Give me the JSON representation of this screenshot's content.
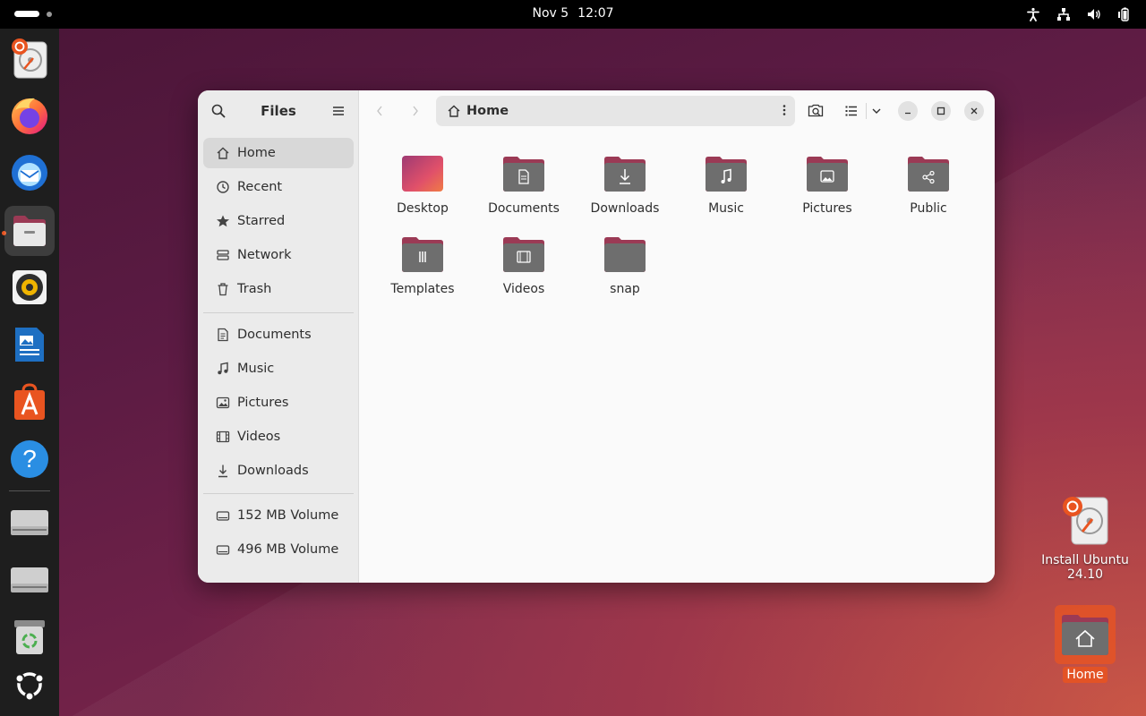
{
  "topbar": {
    "date": "Nov 5",
    "time": "12:07",
    "tray_icons": [
      "accessibility-icon",
      "network-icon",
      "volume-icon",
      "battery-icon"
    ]
  },
  "dock": {
    "apps": [
      {
        "name": "install-ubuntu",
        "icon": "installer-icon"
      },
      {
        "name": "firefox",
        "icon": "firefox-icon"
      },
      {
        "name": "thunderbird",
        "icon": "thunderbird-icon"
      },
      {
        "name": "files",
        "icon": "files-icon",
        "active": true
      },
      {
        "name": "rhythmbox",
        "icon": "rhythmbox-icon"
      },
      {
        "name": "libreoffice-writer",
        "icon": "writer-icon"
      },
      {
        "name": "app-center",
        "icon": "app-center-icon"
      },
      {
        "name": "help",
        "icon": "help-icon"
      },
      {
        "name": "drive-1",
        "icon": "drive-icon"
      },
      {
        "name": "drive-2",
        "icon": "drive-icon"
      },
      {
        "name": "trash",
        "icon": "trash-icon"
      },
      {
        "name": "show-apps",
        "icon": "ubuntu-icon"
      }
    ]
  },
  "window": {
    "sidebar": {
      "title": "Files",
      "places": [
        {
          "label": "Home",
          "icon": "home-icon",
          "selected": true
        },
        {
          "label": "Recent",
          "icon": "recent-icon"
        },
        {
          "label": "Starred",
          "icon": "star-icon"
        },
        {
          "label": "Network",
          "icon": "network-icon"
        },
        {
          "label": "Trash",
          "icon": "trash-icon"
        }
      ],
      "bookmarks": [
        {
          "label": "Documents",
          "icon": "document-icon"
        },
        {
          "label": "Music",
          "icon": "music-icon"
        },
        {
          "label": "Pictures",
          "icon": "picture-icon"
        },
        {
          "label": "Videos",
          "icon": "video-icon"
        },
        {
          "label": "Downloads",
          "icon": "download-icon"
        }
      ],
      "devices": [
        {
          "label": "152 MB Volume",
          "icon": "drive-icon"
        },
        {
          "label": "496 MB Volume",
          "icon": "drive-icon"
        }
      ]
    },
    "path": {
      "label": "Home",
      "icon": "home-icon"
    },
    "files": [
      {
        "label": "Desktop",
        "emblem": "desktop"
      },
      {
        "label": "Documents",
        "emblem": "document"
      },
      {
        "label": "Downloads",
        "emblem": "download"
      },
      {
        "label": "Music",
        "emblem": "music"
      },
      {
        "label": "Pictures",
        "emblem": "picture"
      },
      {
        "label": "Public",
        "emblem": "share"
      },
      {
        "label": "Templates",
        "emblem": "template"
      },
      {
        "label": "Videos",
        "emblem": "video"
      },
      {
        "label": "snap",
        "emblem": "none"
      }
    ]
  },
  "desktop": {
    "icons": [
      {
        "label_line1": "Install Ubuntu",
        "label_line2": "24.10"
      },
      {
        "label_line1": "Home",
        "label_line2": ""
      }
    ]
  },
  "colors": {
    "accent": "#e95420",
    "folder_tab": "#9b3a55",
    "folder_body": "#6e6e6e"
  }
}
